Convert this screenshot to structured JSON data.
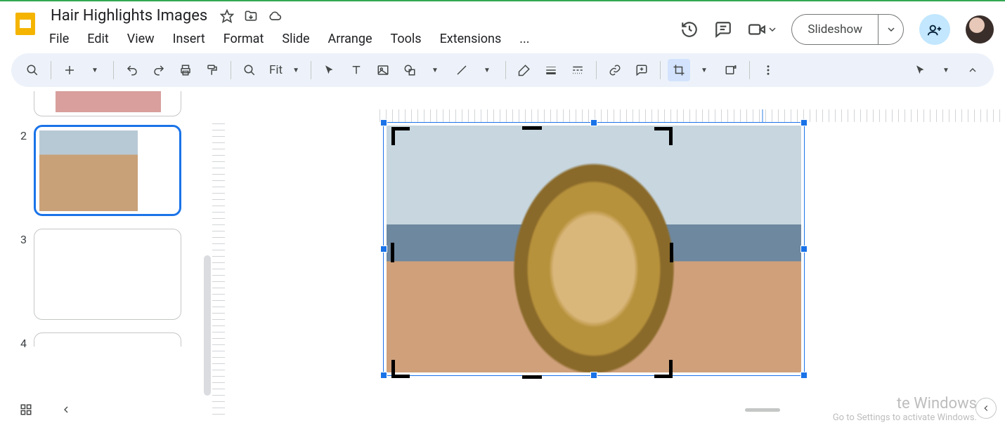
{
  "doc_title": "Hair Highlights Images",
  "menus": {
    "file": "File",
    "edit": "Edit",
    "view": "View",
    "insert": "Insert",
    "format": "Format",
    "slide": "Slide",
    "arrange": "Arrange",
    "tools": "Tools",
    "extensions": "Extensions",
    "more": "..."
  },
  "header": {
    "slideshow_label": "Slideshow"
  },
  "toolbar": {
    "zoom_label": "Fit"
  },
  "slides": {
    "numbers": [
      "2",
      "3",
      "4"
    ],
    "selected_index": 0
  },
  "watermark": {
    "line1": "te Windows",
    "line2": "Go to Settings to activate Windows."
  }
}
